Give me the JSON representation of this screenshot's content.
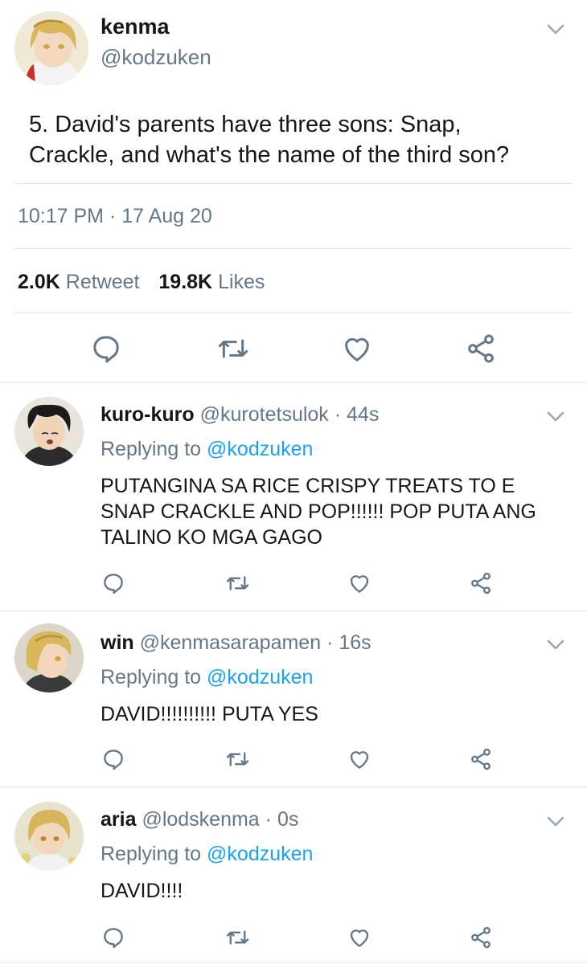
{
  "main_tweet": {
    "display_name": "kenma",
    "handle": "@kodzuken",
    "text_line1": "5. David's parents have three sons: Snap,",
    "text_line2": "Crackle, and what's the name of the third son?",
    "timestamp": "10:17 PM · 17 Aug 20",
    "retweet_count": "2.0K",
    "retweet_label": "Retweet",
    "like_count": "19.8K",
    "like_label": "Likes"
  },
  "replies": [
    {
      "display_name": "kuro-kuro",
      "handle": "@kurotetsulok",
      "time": "· 44s",
      "replying_prefix": "Replying to",
      "replying_to": "@kodzuken",
      "lines": [
        "PUTANGINA SA RICE CRISPY TREATS TO E",
        "SNAP CRACKLE AND POP!!!!!! POP PUTA ANG",
        "TALINO KO MGA GAGO"
      ]
    },
    {
      "display_name": "win",
      "handle": "@kenmasarapamen",
      "time": "· 16s",
      "replying_prefix": "Replying to",
      "replying_to": "@kodzuken",
      "lines": [
        "DAVID!!!!!!!!!! PUTA YES"
      ]
    },
    {
      "display_name": "aria",
      "handle": "@lodskenma",
      "time": "· 0s",
      "replying_prefix": "Replying to",
      "replying_to": "@kodzuken",
      "lines": [
        "DAVID!!!!"
      ]
    }
  ],
  "icons": [
    "reply-icon",
    "retweet-icon",
    "like-icon",
    "share-icon",
    "chevron-down-icon"
  ],
  "colors": {
    "accent": "#1da1f2",
    "secondary_text": "#657786",
    "divider": "#e1e8ed"
  }
}
